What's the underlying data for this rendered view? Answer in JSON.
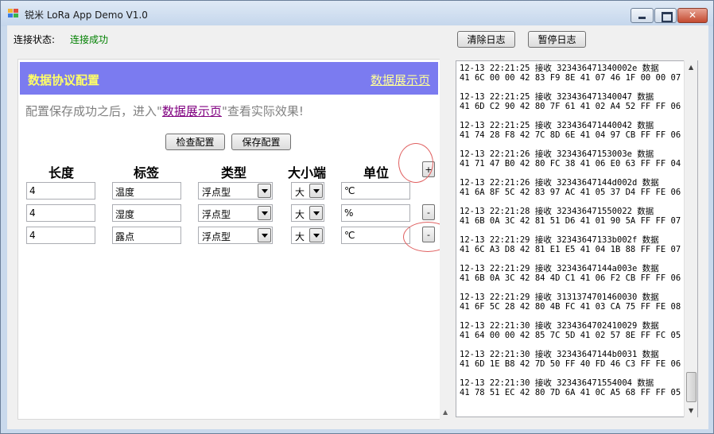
{
  "window": {
    "title": "锐米 LoRa App Demo V1.0",
    "colors": {
      "accent_header": "#7b7bf0",
      "header_text": "#ffff66",
      "status_ok": "#008000"
    }
  },
  "status": {
    "label": "连接状态:",
    "value": "连接成功"
  },
  "toolbar": {
    "clear_log": "清除日志",
    "pause_log": "暂停日志"
  },
  "config": {
    "title": "数据协议配置",
    "display_link": "数据展示页",
    "hint_before": "配置保存成功之后，进入",
    "hint_link": "数据展示页",
    "hint_after": "查看实际效果!",
    "check_button": "检查配置",
    "save_button": "保存配置",
    "columns": {
      "length": "长度",
      "label": "标签",
      "type": "类型",
      "endian": "大小端",
      "unit": "单位"
    },
    "add_button": "+",
    "remove_button": "-",
    "rows": [
      {
        "length": "4",
        "label": "温度",
        "type": "浮点型",
        "endian": "大",
        "unit": "℃"
      },
      {
        "length": "4",
        "label": "湿度",
        "type": "浮点型",
        "endian": "大",
        "unit": "%"
      },
      {
        "length": "4",
        "label": "露点",
        "type": "浮点型",
        "endian": "大",
        "unit": "℃"
      }
    ]
  },
  "log": [
    {
      "header": "12-13 22:21:25 接收 323436471340002e 数据",
      "bytes": "41 6C 00 00 42 83 F9 8E 41 07 46 1F 00 00 07"
    },
    {
      "header": "12-13 22:21:25 接收 323436471340047 数据",
      "bytes": "41 6D C2 90 42 80 7F 61 41 02 A4 52 FF FF 06"
    },
    {
      "header": "12-13 22:21:25 接收 323436471440042 数据",
      "bytes": "41 74 28 F8 42 7C 8D 6E 41 04 97 CB FF FF 06"
    },
    {
      "header": "12-13 22:21:26 接收 32343647153003e 数据",
      "bytes": "41 71 47 B0 42 80 FC 38 41 06 E0 63 FF FF 04"
    },
    {
      "header": "12-13 22:21:26 接收 32343647144d002d 数据",
      "bytes": "41 6A 8F 5C 42 83 97 AC 41 05 37 D4 FF FE 06"
    },
    {
      "header": "12-13 22:21:28 接收 323436471550022 数据",
      "bytes": "41 6B 0A 3C 42 81 51 D6 41 01 90 5A FF FF 07"
    },
    {
      "header": "12-13 22:21:29 接收 32343647133b002f 数据",
      "bytes": "41 6C A3 D8 42 81 E1 E5 41 04 1B 88 FF FE 07"
    },
    {
      "header": "12-13 22:21:29 接收 32343647144a003e 数据",
      "bytes": "41 6B 0A 3C 42 84 4D C1 41 06 F2 CB FF FF 06"
    },
    {
      "header": "12-13 22:21:29 接收 3131374701460030 数据",
      "bytes": "41 6F 5C 28 42 80 4B FC 41 03 CA 75 FF FE 08"
    },
    {
      "header": "12-13 22:21:30 接收 3234364702410029 数据",
      "bytes": "41 64 00 00 42 85 7C 5D 41 02 57 8E FF FC 05"
    },
    {
      "header": "12-13 22:21:30 接收 32343647144b0031 数据",
      "bytes": "41 6D 1E B8 42 7D 50 FF 40 FD 46 C3 FF FE 06"
    },
    {
      "header": "12-13 22:21:30 接收 323436471554004 数据",
      "bytes": "41 78 51 EC 42 80 7D 6A 41 0C A5 68 FF FF 05"
    }
  ]
}
